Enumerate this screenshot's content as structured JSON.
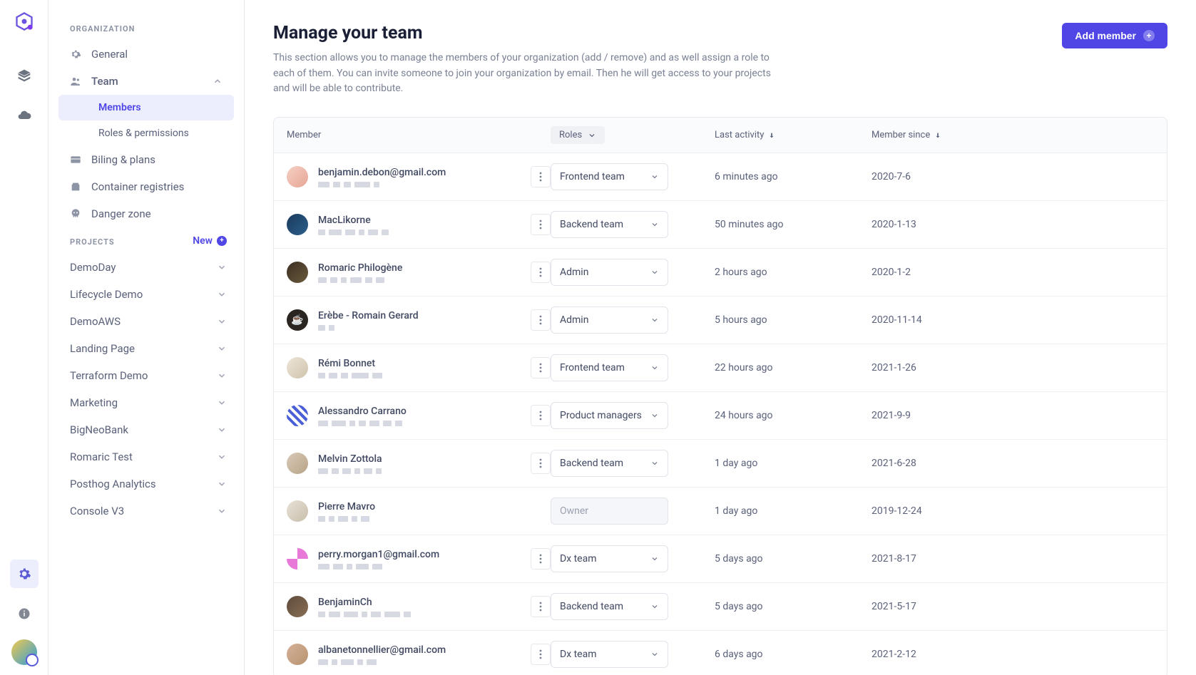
{
  "sidebar": {
    "org_section_title": "ORGANIZATION",
    "general": "General",
    "team": "Team",
    "members": "Members",
    "roles_permissions": "Roles & permissions",
    "billing": "Biling & plans",
    "registries": "Container registries",
    "danger": "Danger zone",
    "projects_section_title": "PROJECTS",
    "new_label": "New",
    "projects": [
      {
        "name": "DemoDay"
      },
      {
        "name": "Lifecycle Demo"
      },
      {
        "name": "DemoAWS"
      },
      {
        "name": "Landing Page"
      },
      {
        "name": "Terraform Demo"
      },
      {
        "name": "Marketing"
      },
      {
        "name": "BigNeoBank"
      },
      {
        "name": "Romaric Test"
      },
      {
        "name": "Posthog Analytics"
      },
      {
        "name": "Console V3"
      }
    ]
  },
  "header": {
    "title": "Manage your team",
    "description": "This section allows you to manage the members of your organization (add / remove) and as well assign a role to each of them. You can invite someone to join your organization by email. Then he will get access to your projects and will be able to contribute.",
    "add_member": "Add member"
  },
  "table": {
    "cols": {
      "member": "Member",
      "roles": "Roles",
      "activity": "Last activity",
      "since": "Member since"
    },
    "rows": [
      {
        "name": "benjamin.debon@gmail.com",
        "role": "Frontend team",
        "activity": "6 minutes ago",
        "since": "2020-7-6",
        "av": "av1",
        "owner": false
      },
      {
        "name": "MacLikorne",
        "role": "Backend team",
        "activity": "50 minutes ago",
        "since": "2020-1-13",
        "av": "av2",
        "owner": false
      },
      {
        "name": "Romaric Philogène",
        "role": "Admin",
        "activity": "2 hours ago",
        "since": "2020-1-2",
        "av": "av3",
        "owner": false
      },
      {
        "name": "Erèbe - Romain Gerard",
        "role": "Admin",
        "activity": "5 hours ago",
        "since": "2020-11-14",
        "av": "av4",
        "owner": false
      },
      {
        "name": "Rémi Bonnet",
        "role": "Frontend team",
        "activity": "22 hours ago",
        "since": "2021-1-26",
        "av": "av5",
        "owner": false
      },
      {
        "name": "Alessandro Carrano",
        "role": "Product managers",
        "activity": "24 hours ago",
        "since": "2021-9-9",
        "av": "av6",
        "owner": false
      },
      {
        "name": "Melvin Zottola",
        "role": "Backend team",
        "activity": "1 day ago",
        "since": "2021-6-28",
        "av": "av7",
        "owner": false
      },
      {
        "name": "Pierre Mavro",
        "role": "Owner",
        "activity": "1 day ago",
        "since": "2019-12-24",
        "av": "av8",
        "owner": true
      },
      {
        "name": "perry.morgan1@gmail.com",
        "role": "Dx team",
        "activity": "5 days ago",
        "since": "2021-8-17",
        "av": "av9",
        "owner": false
      },
      {
        "name": "BenjaminCh",
        "role": "Backend team",
        "activity": "5 days ago",
        "since": "2021-5-17",
        "av": "av10",
        "owner": false
      },
      {
        "name": "albanetonnellier@gmail.com",
        "role": "Dx team",
        "activity": "6 days ago",
        "since": "2021-2-12",
        "av": "av11",
        "owner": false
      }
    ]
  }
}
